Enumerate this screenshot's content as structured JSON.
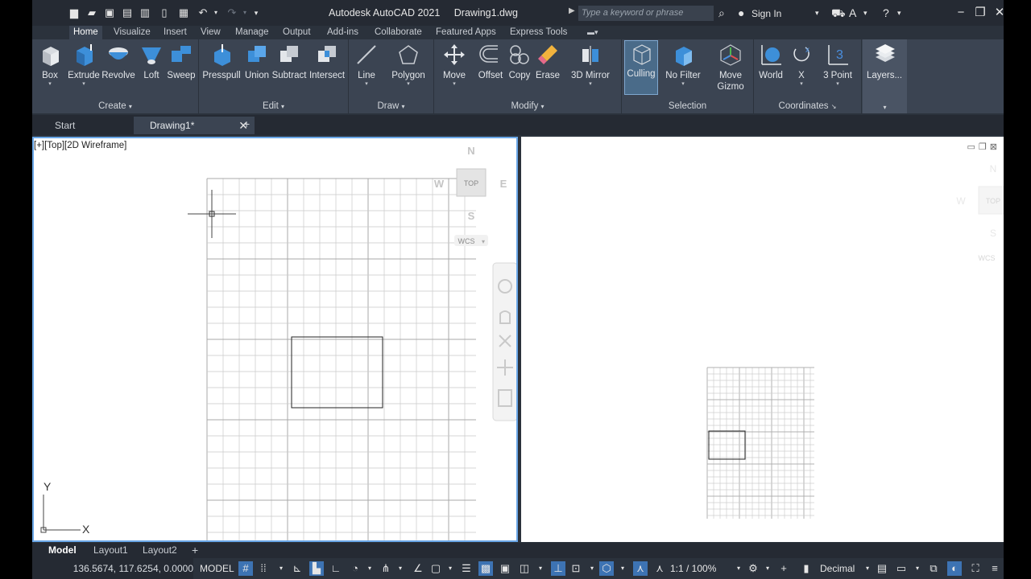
{
  "app": {
    "name": "Autodesk AutoCAD 2021",
    "document": "Drawing1.dwg"
  },
  "search": {
    "placeholder": "Type a keyword or phrase"
  },
  "account": {
    "sign_in": "Sign In"
  },
  "ribbon_tabs": [
    "Home",
    "Visualize",
    "Insert",
    "View",
    "Manage",
    "Output",
    "Add-ins",
    "Collaborate",
    "Featured Apps",
    "Express Tools"
  ],
  "groups": {
    "create": {
      "label": "Create",
      "tools": [
        "Box",
        "Extrude",
        "Revolve",
        "Loft",
        "Sweep"
      ]
    },
    "edit": {
      "label": "Edit",
      "tools": [
        "Presspull",
        "Union",
        "Subtract",
        "Intersect"
      ]
    },
    "draw": {
      "label": "Draw",
      "tools": [
        "Line",
        "Polygon"
      ]
    },
    "modify": {
      "label": "Modify",
      "tools": [
        "Move",
        "Offset",
        "Copy",
        "Erase",
        "3D Mirror"
      ]
    },
    "selection": {
      "label": "Selection",
      "tools": [
        "Culling",
        "No Filter",
        "Move Gizmo"
      ]
    },
    "coordinates": {
      "label": "Coordinates",
      "tools": [
        "World",
        "X",
        "3 Point"
      ]
    },
    "layers": {
      "label": "Layers..."
    }
  },
  "file_tabs": {
    "start": "Start",
    "drawing": "Drawing1*"
  },
  "viewport": {
    "label": "[+][Top][2D Wireframe]",
    "viewcube": {
      "top": "TOP",
      "n": "N",
      "s": "S",
      "e": "E",
      "w": "W",
      "wcs": "WCS"
    },
    "ucs": {
      "x": "X",
      "y": "Y"
    }
  },
  "layout_tabs": [
    "Model",
    "Layout1",
    "Layout2"
  ],
  "status": {
    "coordinates": "136.5674, 117.6254, 0.0000",
    "model": "MODEL",
    "scale": "1:1 / 100%",
    "units": "Decimal"
  },
  "colors": {
    "accent": "#6aa7e8",
    "ribbon": "#3b4452",
    "grid": "#b8b8b8"
  }
}
